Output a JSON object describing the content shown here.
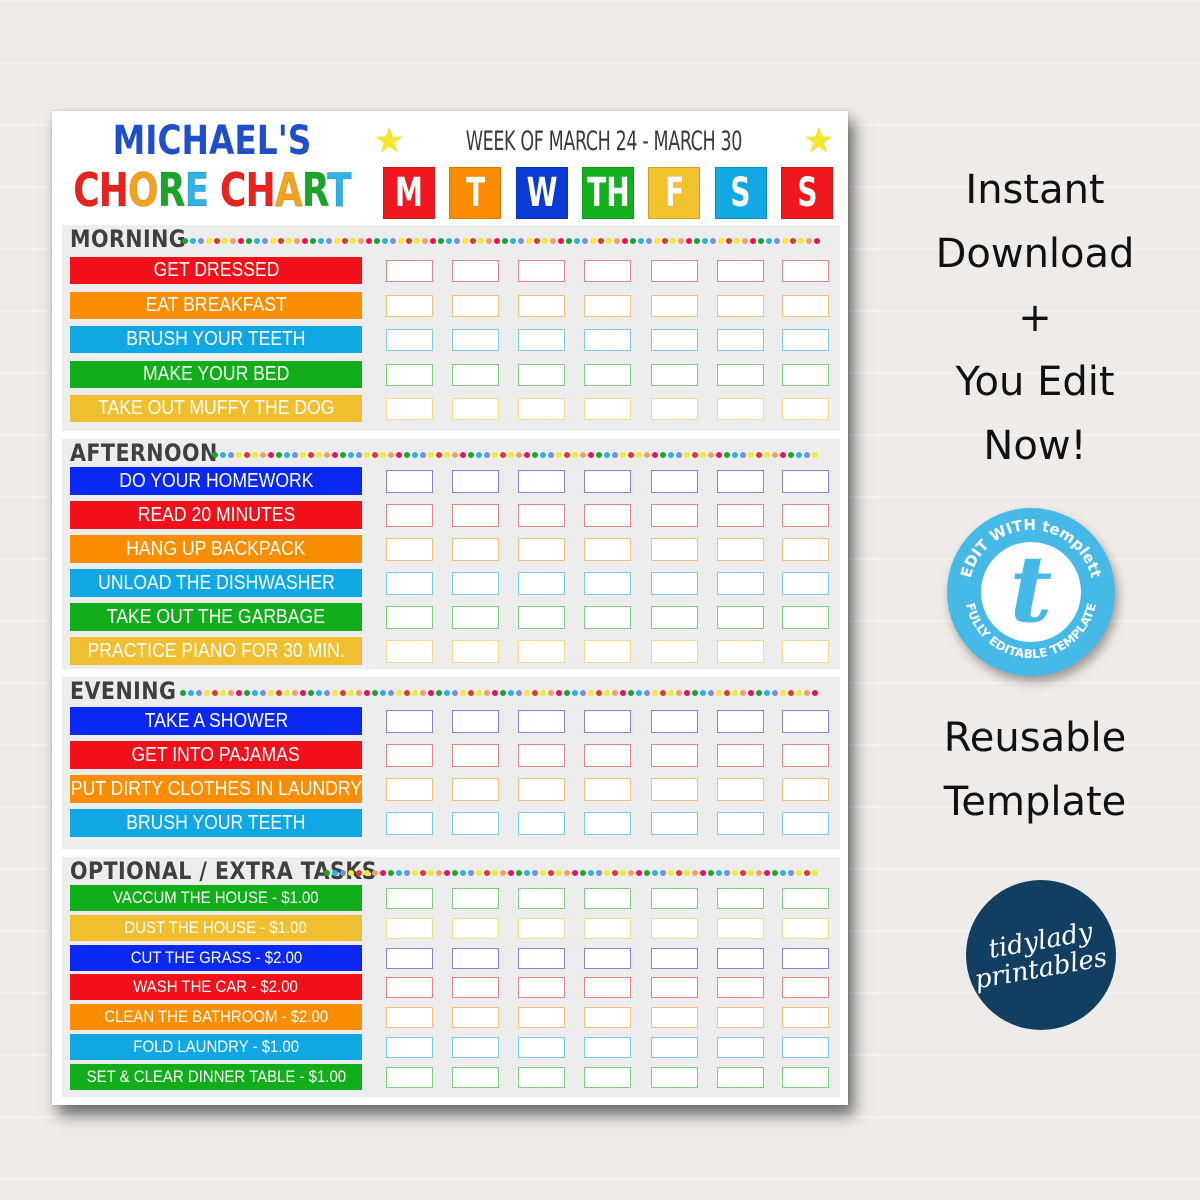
{
  "title": {
    "line1": "MICHAEL'S",
    "line2_letters": [
      {
        "ch": "C",
        "color": "#e8231e"
      },
      {
        "ch": "H",
        "color": "#e8231e"
      },
      {
        "ch": "O",
        "color": "#f6a21d"
      },
      {
        "ch": "R",
        "color": "#1aa52a"
      },
      {
        "ch": "E",
        "color": "#2fb2e6"
      },
      {
        "ch": " ",
        "color": "#ffffff"
      },
      {
        "ch": "C",
        "color": "#e8231e"
      },
      {
        "ch": "H",
        "color": "#e8231e"
      },
      {
        "ch": "A",
        "color": "#f6a21d"
      },
      {
        "ch": "R",
        "color": "#1aa52a"
      },
      {
        "ch": "T",
        "color": "#2fb2e6"
      }
    ],
    "title_color": "#1e4fc8"
  },
  "week": {
    "label": "WEEK OF MARCH 24 - MARCH 30",
    "star_icon": "★"
  },
  "days": [
    {
      "label": "M",
      "color": "#f0181e"
    },
    {
      "label": "T",
      "color": "#fb8c00"
    },
    {
      "label": "W",
      "color": "#0a3bd4"
    },
    {
      "label": "TH",
      "color": "#14b11e"
    },
    {
      "label": "F",
      "color": "#f2c12e"
    },
    {
      "label": "S",
      "color": "#12a9e2"
    },
    {
      "label": "S",
      "color": "#f0181e"
    }
  ],
  "colors": {
    "red": "#f2111a",
    "orange": "#fb8e00",
    "blue": "#0a28f2",
    "green": "#11ad1a",
    "yellow": "#efbf2f",
    "sky": "#10a8e4"
  },
  "box_colors": {
    "red": "#e48585",
    "orange": "#f3c27a",
    "blue": "#7d86e0",
    "green": "#7fcc82",
    "yellow": "#f4d98a",
    "sky": "#7fcbe6"
  },
  "dot_colors": [
    "#1aa52a",
    "#2fb2e6",
    "#7f8fd0",
    "#f2e934",
    "#e8391e",
    "#f2e934",
    "#f4a06a",
    "#e8125a"
  ],
  "sections": [
    {
      "title": "MORNING",
      "tasks": [
        {
          "label": "GET DRESSED",
          "color": "red"
        },
        {
          "label": "EAT BREAKFAST",
          "color": "orange"
        },
        {
          "label": "BRUSH YOUR TEETH",
          "color": "sky"
        },
        {
          "label": "MAKE YOUR BED",
          "color": "green"
        },
        {
          "label": "TAKE OUT MUFFY THE DOG",
          "color": "yellow"
        }
      ]
    },
    {
      "title": "AFTERNOON",
      "tasks": [
        {
          "label": "DO YOUR HOMEWORK",
          "color": "blue"
        },
        {
          "label": "READ 20 MINUTES",
          "color": "red"
        },
        {
          "label": "HANG UP BACKPACK",
          "color": "orange"
        },
        {
          "label": "UNLOAD THE DISHWASHER",
          "color": "sky"
        },
        {
          "label": "TAKE OUT THE GARBAGE",
          "color": "green"
        },
        {
          "label": "PRACTICE PIANO FOR 30 MIN.",
          "color": "yellow"
        }
      ]
    },
    {
      "title": "EVENING",
      "tasks": [
        {
          "label": "TAKE A SHOWER",
          "color": "blue"
        },
        {
          "label": "GET INTO PAJAMAS",
          "color": "red"
        },
        {
          "label": "PUT DIRTY CLOTHES IN LAUNDRY",
          "color": "orange"
        },
        {
          "label": "BRUSH YOUR TEETH",
          "color": "sky"
        }
      ]
    },
    {
      "title": "OPTIONAL / EXTRA TASKS",
      "tasks": [
        {
          "label": "VACCUM THE HOUSE - $1.00",
          "color": "green"
        },
        {
          "label": "DUST THE HOUSE - $1.00",
          "color": "yellow"
        },
        {
          "label": "CUT THE GRASS - $2.00",
          "color": "blue"
        },
        {
          "label": "WASH THE CAR - $2.00",
          "color": "red"
        },
        {
          "label": "CLEAN THE BATHROOM - $2.00",
          "color": "orange"
        },
        {
          "label": "FOLD LAUNDRY - $1.00",
          "color": "sky"
        },
        {
          "label": "SET & CLEAR DINNER TABLE - $1.00",
          "color": "green"
        }
      ]
    }
  ],
  "side": {
    "promo1_lines": [
      "Instant",
      "Download",
      "+",
      "You Edit",
      "Now!"
    ],
    "badge": {
      "top_text": "EDIT WITH templett",
      "bottom_text": "FULLY EDITABLE TEMPLATE",
      "letter": "t"
    },
    "promo2_lines": [
      "Reusable",
      "Template"
    ],
    "logo_lines": [
      "tidylady",
      "printables"
    ]
  }
}
